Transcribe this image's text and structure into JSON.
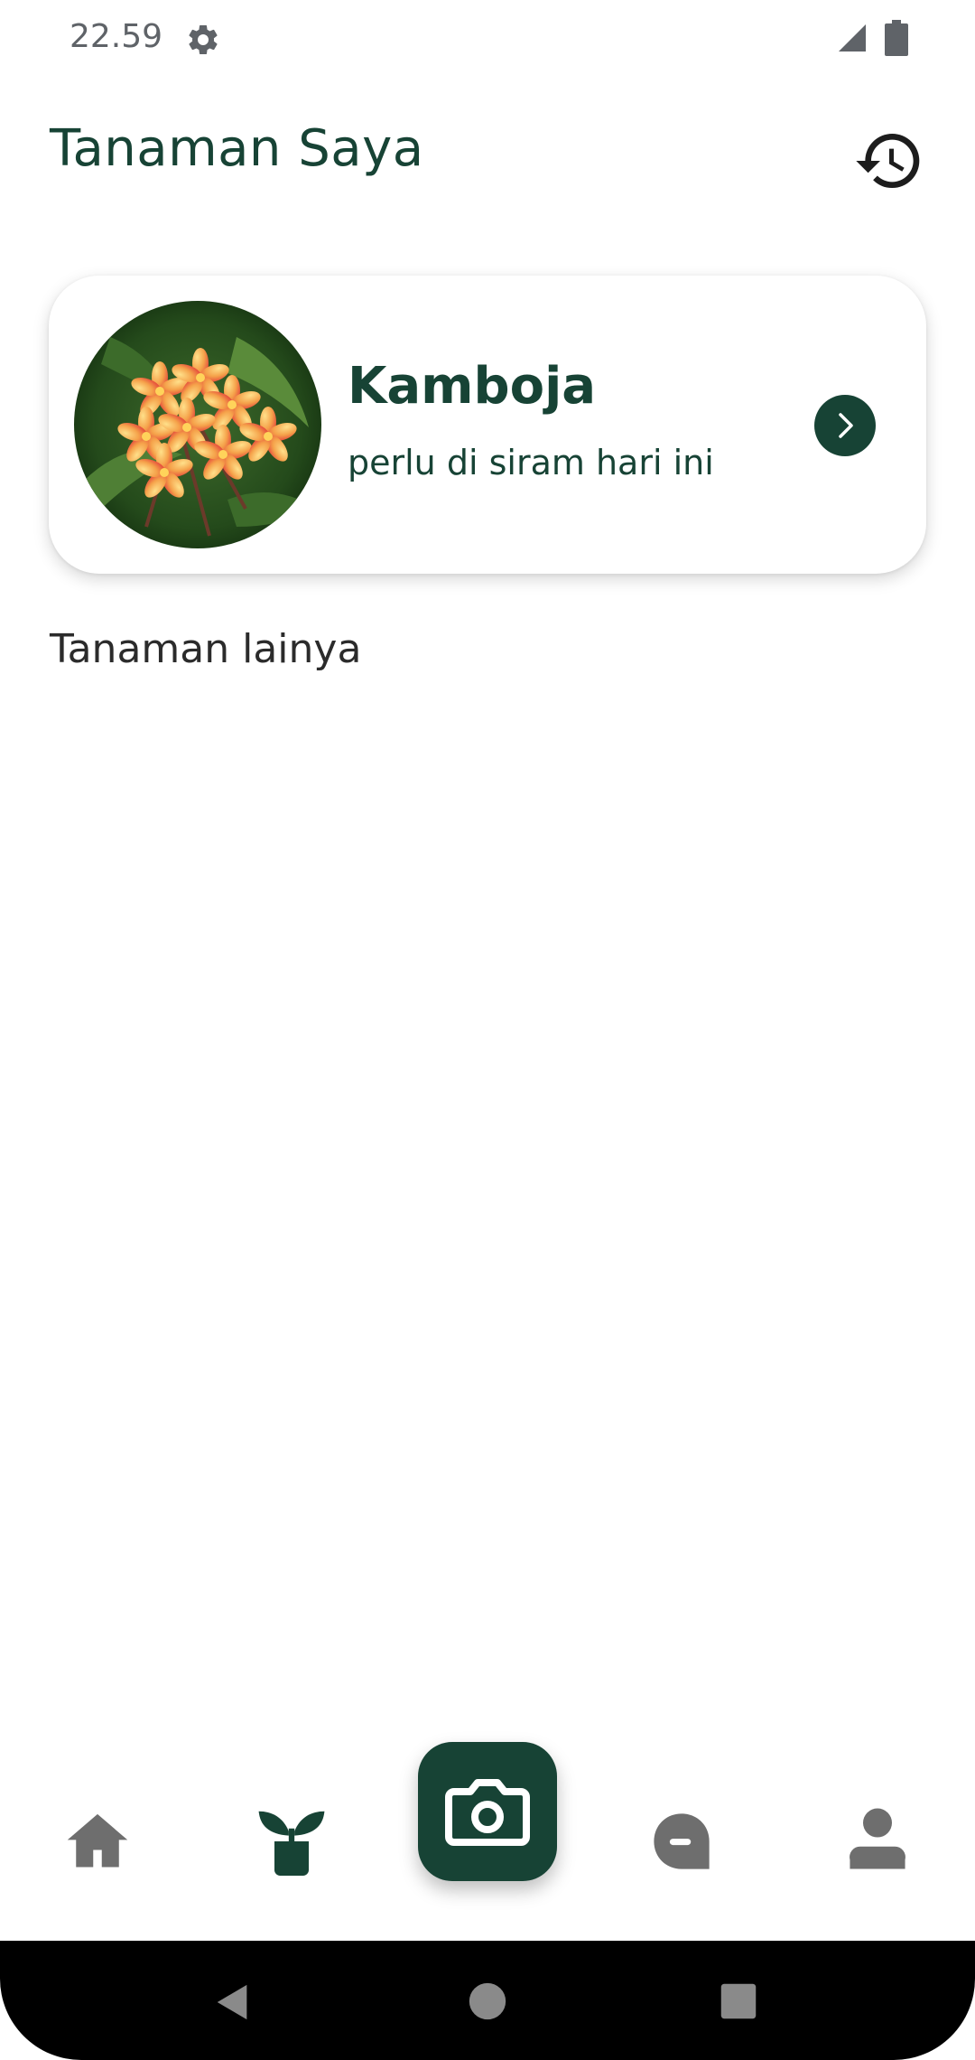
{
  "status_bar": {
    "time": "22.59",
    "icons": [
      "gear-icon",
      "signal-icon",
      "battery-icon"
    ]
  },
  "header": {
    "title": "Tanaman Saya",
    "history_icon": "history-icon"
  },
  "featured_plant": {
    "name": "Kamboja",
    "status": "perlu di siram hari ini",
    "photo": "frangipani-flowers",
    "action_icon": "chevron-right-icon"
  },
  "other_plants": {
    "title": "Tanaman lainya"
  },
  "bottom_nav": {
    "items": [
      "home-icon",
      "plant-icon",
      "camera-icon",
      "chat-icon",
      "profile-icon"
    ],
    "active": "plant-icon"
  },
  "colors": {
    "primary": "#174335",
    "inactive_icon": "#6e6e6e",
    "background": "#ffffff"
  }
}
